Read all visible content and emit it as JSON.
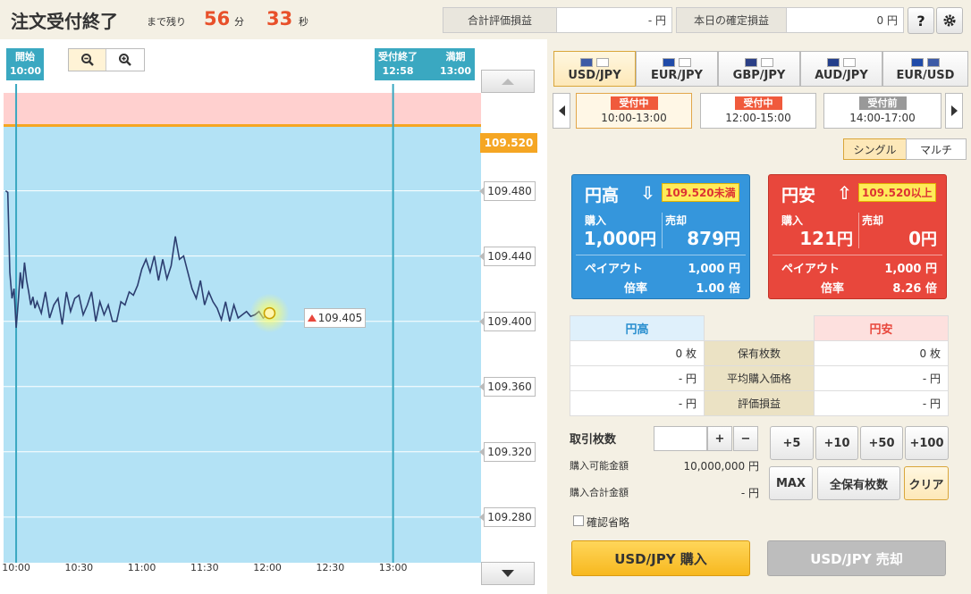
{
  "header": {
    "title": "注文受付終了",
    "remain_label": "まで残り",
    "minutes": "56",
    "minutes_unit": "分",
    "seconds": "33",
    "seconds_unit": "秒",
    "total_eval_label": "合計評価損益",
    "total_eval_value": "- 円",
    "today_label": "本日の確定損益",
    "today_value": "0 円",
    "help_label": "?",
    "settings_icon": "gear-icon"
  },
  "chart": {
    "start_tag": {
      "label": "開始",
      "time": "10:00"
    },
    "close_tag": {
      "label": "受付終了",
      "time": "12:58"
    },
    "expire_tag": {
      "label": "満期",
      "time": "13:00"
    },
    "zoom_out_icon": "zoom-out-icon",
    "zoom_in_icon": "zoom-in-icon",
    "strike_label": "109.520",
    "current_label": "109.405",
    "accent_strike": "#f5a623",
    "zone_above": "#ffd0cf",
    "zone_below": "#b3e2f5",
    "line_color": "#2c3e70"
  },
  "chart_data": {
    "type": "line",
    "title": "",
    "y_ticks": [
      "109.480",
      "109.440",
      "109.400",
      "109.360",
      "109.320",
      "109.280"
    ],
    "x_ticks": [
      "10:00",
      "10:30",
      "11:00",
      "11:30",
      "12:00",
      "12:30",
      "13:00"
    ],
    "ylim": [
      109.252,
      109.54
    ],
    "xlim": [
      "09:54",
      "13:42"
    ],
    "strike": 109.52,
    "series": [
      {
        "x": [
          "09:55",
          "09:56",
          "09:57",
          "09:58",
          "09:59",
          "10:00",
          "10:01",
          "10:02",
          "10:03",
          "10:04",
          "10:05",
          "10:06",
          "10:07",
          "10:08",
          "10:09",
          "10:10",
          "10:12",
          "10:14",
          "10:16",
          "10:18",
          "10:20",
          "10:22",
          "10:24",
          "10:26",
          "10:28",
          "10:30",
          "10:32",
          "10:34",
          "10:36",
          "10:38",
          "10:40",
          "10:42",
          "10:44",
          "10:46",
          "10:48",
          "10:50",
          "10:52",
          "10:54",
          "10:56",
          "10:58",
          "11:00",
          "11:02",
          "11:04",
          "11:06",
          "11:08",
          "11:10",
          "11:12",
          "11:14",
          "11:16",
          "11:18",
          "11:20",
          "11:22",
          "11:24",
          "11:26",
          "11:28",
          "11:30",
          "11:32",
          "11:34",
          "11:36",
          "11:38",
          "11:40",
          "11:42",
          "11:44",
          "11:46",
          "11:48",
          "11:50",
          "11:52",
          "11:54",
          "11:56",
          "11:58",
          "12:00",
          "12:01"
        ],
        "values": [
          109.48,
          109.479,
          109.43,
          109.414,
          109.42,
          109.396,
          109.412,
          109.43,
          109.42,
          109.436,
          109.425,
          109.418,
          109.41,
          109.415,
          109.408,
          109.412,
          109.405,
          109.418,
          109.402,
          109.41,
          109.414,
          109.398,
          109.418,
          109.406,
          109.414,
          109.416,
          109.404,
          109.41,
          109.418,
          109.4,
          109.412,
          109.404,
          109.41,
          109.4,
          109.4,
          109.412,
          109.41,
          109.418,
          109.416,
          109.422,
          109.432,
          109.438,
          109.43,
          109.44,
          109.425,
          109.438,
          109.426,
          109.434,
          109.452,
          109.438,
          109.44,
          109.43,
          109.42,
          109.414,
          109.425,
          109.41,
          109.418,
          109.412,
          109.408,
          109.401,
          109.412,
          109.4,
          109.41,
          109.402,
          109.404,
          109.406,
          109.403,
          109.404,
          109.406,
          109.402,
          109.404,
          109.405
        ]
      }
    ]
  },
  "pairs": [
    {
      "label": "USD/JPY",
      "flags": [
        "#3c5aa6",
        "#ffffff"
      ],
      "selected": true
    },
    {
      "label": "EUR/JPY",
      "flags": [
        "#1f4aa8",
        "#ffffff"
      ],
      "selected": false
    },
    {
      "label": "GBP/JPY",
      "flags": [
        "#2b3f86",
        "#ffffff"
      ],
      "selected": false
    },
    {
      "label": "AUD/JPY",
      "flags": [
        "#233e8b",
        "#ffffff"
      ],
      "selected": false
    },
    {
      "label": "EUR/USD",
      "flags": [
        "#1f4aa8",
        "#3c5aa6"
      ],
      "selected": false
    }
  ],
  "slots": [
    {
      "status": "受付中",
      "time": "10:00-13:00",
      "color": "#f05a3c"
    },
    {
      "status": "受付中",
      "time": "12:00-15:00",
      "color": "#f05a3c"
    },
    {
      "status": "受付前",
      "time": "14:00-17:00",
      "color": "#999999"
    }
  ],
  "mode": {
    "single": "シングル",
    "multi": "マルチ"
  },
  "high_card": {
    "title": "円高",
    "threshold": "109.520未満",
    "buy_label": "購入",
    "sell_label": "売却",
    "buy_value": "1,000",
    "sell_value": "879",
    "yen": "円",
    "payout_label": "ペイアウト",
    "payout_value": "1,000 円",
    "rate_label": "倍率",
    "rate_value": "1.00 倍",
    "color": "#3596dc"
  },
  "low_card": {
    "title": "円安",
    "threshold": "109.520以上",
    "buy_label": "購入",
    "sell_label": "売却",
    "buy_value": "121",
    "sell_value": "0",
    "yen": "円",
    "payout_label": "ペイアウト",
    "payout_value": "1,000 円",
    "rate_label": "倍率",
    "rate_value": "8.26 倍",
    "color": "#e8473c"
  },
  "positions": {
    "high_header": "円高",
    "low_header": "円安",
    "rows": [
      {
        "label": "保有枚数",
        "high": "0 枚",
        "low": "0 枚"
      },
      {
        "label": "平均購入価格",
        "high": "- 円",
        "low": "- 円"
      },
      {
        "label": "評価損益",
        "high": "- 円",
        "low": "- 円"
      }
    ]
  },
  "order": {
    "qty_label": "取引枚数",
    "qty_value": "",
    "plus": "+",
    "minus": "−",
    "inc": [
      "+5",
      "+10",
      "+50",
      "+100"
    ],
    "avail_label": "購入可能金額",
    "avail_value": "10,000,000 円",
    "total_label": "購入合計金額",
    "total_value": "- 円",
    "max": "MAX",
    "all_hold": "全保有枚数",
    "clear": "クリア",
    "confirm_label": "確認省略",
    "buy_btn": "USD/JPY 購入",
    "sell_btn": "USD/JPY 売却"
  }
}
